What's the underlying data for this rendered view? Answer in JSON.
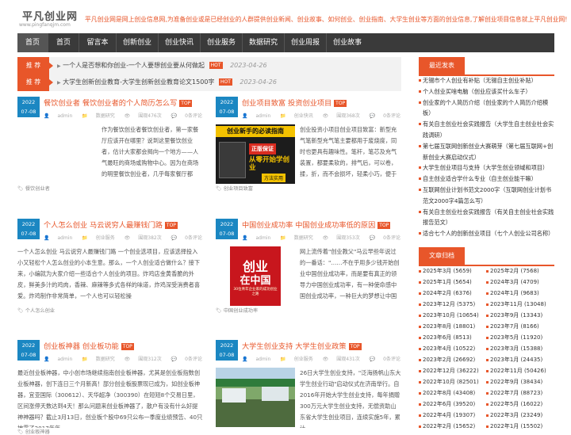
{
  "site": {
    "logo_title": "平凡创业网",
    "logo_url": "www.pingfanqjm.com",
    "intro": "平凡创业网是网上创业信息网,为准备创业或是已经创业的人群提供创业新闻、创业故事、如何创业、创业指南、大学生创业等方面的创业信息,了解创业项目信息就上平凡创业网!"
  },
  "nav": [
    "首页",
    "首页",
    "留言本",
    "创新创业",
    "创业快讯",
    "创业服务",
    "数据研究",
    "创业周报",
    "创业故事"
  ],
  "featured": {
    "label": "推 荐",
    "hot": "HOT",
    "items": [
      {
        "text": "一个人是否想和你创业-一个人要想创业要从何做起",
        "date": "2023-04-26"
      },
      {
        "text": "大学生创新创业教育-大学生创新创业教育论文1500字",
        "date": "2023-04-26"
      }
    ]
  },
  "top_badge": "TOP",
  "posts": [
    {
      "year": "2022",
      "day": "07-08",
      "title": "餐饮创业者 餐饮创业者的个人简历怎么写",
      "author": "admin",
      "category": "数据研究",
      "views": "围观476次",
      "comments": "0条评论",
      "body": "作为餐饮创业者餐饮创业者，第一家餐厅应该开在哪里？说到这里餐饮创业者，估计大家都会揭向一个地方——人气最旺的商场或购物中心。因为在商场的明里餐饮创业者，几乎每家餐厅都",
      "tag": "餐饮创业者"
    },
    {
      "year": "2022",
      "day": "07-08",
      "title": "创业项目致富 投资创业项目",
      "author": "admin",
      "category": "创业快讯",
      "views": "围观368次",
      "comments": "0条评论",
      "body": "创业投资小项目创业项目致富：新型充气笔新型充气笔主要都用于废烧度，同时也更具有趣味性。笔杆，笔芯及充气装置，都要柔软的，排气后，可以卷，揉，折，而不会损坏，轻柔小巧，便于",
      "tag": "创业项目致富",
      "book_title": "创业新手的必读指南",
      "book_sub": "从零开始学创业",
      "book_badge": "正版保证",
      "book_footer": "方法实用"
    },
    {
      "year": "2022",
      "day": "07-08",
      "title": "个人怎么创业 马云说穷人最赚钱门路",
      "author": "admin",
      "category": "创业服务",
      "views": "围观382次",
      "comments": "0条评论",
      "body": "一个人怎么创业 马云说穷人最赚钱门路 一个创业选项目，应该选择投入小又轻松个人怎么创业的小本生意。那么，一个人创业适合做什么？接下来，小编就为大家介绍一些适合个人创业的项目。炸鸡店金黄香脆的外皮，鲜美多汁的鸡肉，香辣、麻辣等多式各样的味道，炸鸡深受消费者喜爱。炸鸡制作非常简单，一个人也可以轻松操",
      "tag": "个人怎么创业",
      "img_alt": "个人怎么创业 马云说穷人最赚钱门路"
    },
    {
      "year": "2022",
      "day": "07-08",
      "title": "中国创业成功率 中国创业成功率低的原因",
      "author": "admin",
      "category": "数据研究",
      "views": "围观353次",
      "comments": "0条评论",
      "body": "网上流传着\"创业教父\"马云早些年说过的一番话：\"……不在乎用多少钱开始创业中国创业成功率，而是要有真正的领导力中国创业成功率，有一种使命感中国创业成功率，一种巨大的梦想让中国",
      "tag": "中国创业成功率",
      "book_title": "创业",
      "book_title2": "在中国",
      "book_sub": "30位青年企业家的成功创业之路"
    },
    {
      "year": "2022",
      "day": "07-08",
      "title": "创业板神器 创业板功能",
      "author": "admin",
      "category": "数据研究",
      "views": "围观312次",
      "comments": "0条评论",
      "body": "最近创业板神器，中小创市场继续指南创业板神器，尤其是创业板指数创业板神器，创下连日三个月新高！部分创业板股票现已成为，如创业板神器，宜亚国际（300612）、天华超净（300390）在短短8个交易日里，区间涨停天数达到4天！那么问题来创业板神器了，散户有没有什么好提神神器吗？截止3月13日，创业板个股中69只公布一季度业绩预告、40只披露了2017年年",
      "tag": "创业板神器"
    },
    {
      "year": "2022",
      "day": "07-08",
      "title": "大学生创业支持 大学生创业政策",
      "author": "admin",
      "category": "创业服务",
      "views": "围观431次",
      "comments": "0条评论",
      "body": "26日大学生创业支持，\"泛海扬帆山东大学生创业行动\"启动仪式在济南举行。自2016年开始大学生创业支持，每年捐赠300万元大学生创业支持，无偿资助山东省大学生创业项目，连续实施5年，累计",
      "tag": "大学生创业支持"
    }
  ],
  "sidebar": {
    "latest_title": "最近发表",
    "latest": [
      "无锡市个人创业有补贴（无锡自主创业补贴）",
      "个人创业买啥电脑（创业应该买什么车子）",
      "创业家的个人简历介绍（创业家的个人简历介绍模板）",
      "有关自主创业社会实践报告（大学生自主创业社会实践调研）",
      "第七届互联网创新创业大赛萌芽（第七届互联网+创新创业大赛启动仪式）",
      "大学生创业项目与支持（大学生创业领域和项目）",
      "自主创业适合学什么专业（自主创业能干嘛）",
      "互联网创业计划书范文2000字（互联网创业计划书范文2000字4篇怎么写）",
      "有关自主创业社会实践报告（有关自主创业社会实践报告范文）",
      "适合七个人的创新创业项目（七个人创业公司名称）"
    ],
    "archive_title": "文章归档",
    "archive": [
      [
        "2025年3月 (5659)",
        "2025年2月 (7568)"
      ],
      [
        "2025年1月 (5654)",
        "2024年3月 (4709)"
      ],
      [
        "2024年2月 (6376)",
        "2024年1月 (9683)"
      ],
      [
        "2023年12月 (5375)",
        "2023年11月 (13048)"
      ],
      [
        "2023年10月 (10654)",
        "2023年9月 (13343)"
      ],
      [
        "2023年8月 (18801)",
        "2023年7月 (8166)"
      ],
      [
        "2023年6月 (8513)",
        "2023年5月 (11920)"
      ],
      [
        "2023年4月 (10522)",
        "2023年3月 (15388)"
      ],
      [
        "2023年2月 (26692)",
        "2023年1月 (24435)"
      ],
      [
        "2022年12月 (36222)",
        "2022年11月 (50426)"
      ],
      [
        "2022年10月 (82501)",
        "2022年9月 (38434)"
      ],
      [
        "2022年8月 (43408)",
        "2022年7月 (88723)"
      ],
      [
        "2022年6月 (39520)",
        "2022年5月 (16022)"
      ],
      [
        "2022年4月 (19307)",
        "2022年3月 (23249)"
      ],
      [
        "2022年2月 (15652)",
        "2022年1月 (15502)"
      ]
    ]
  }
}
